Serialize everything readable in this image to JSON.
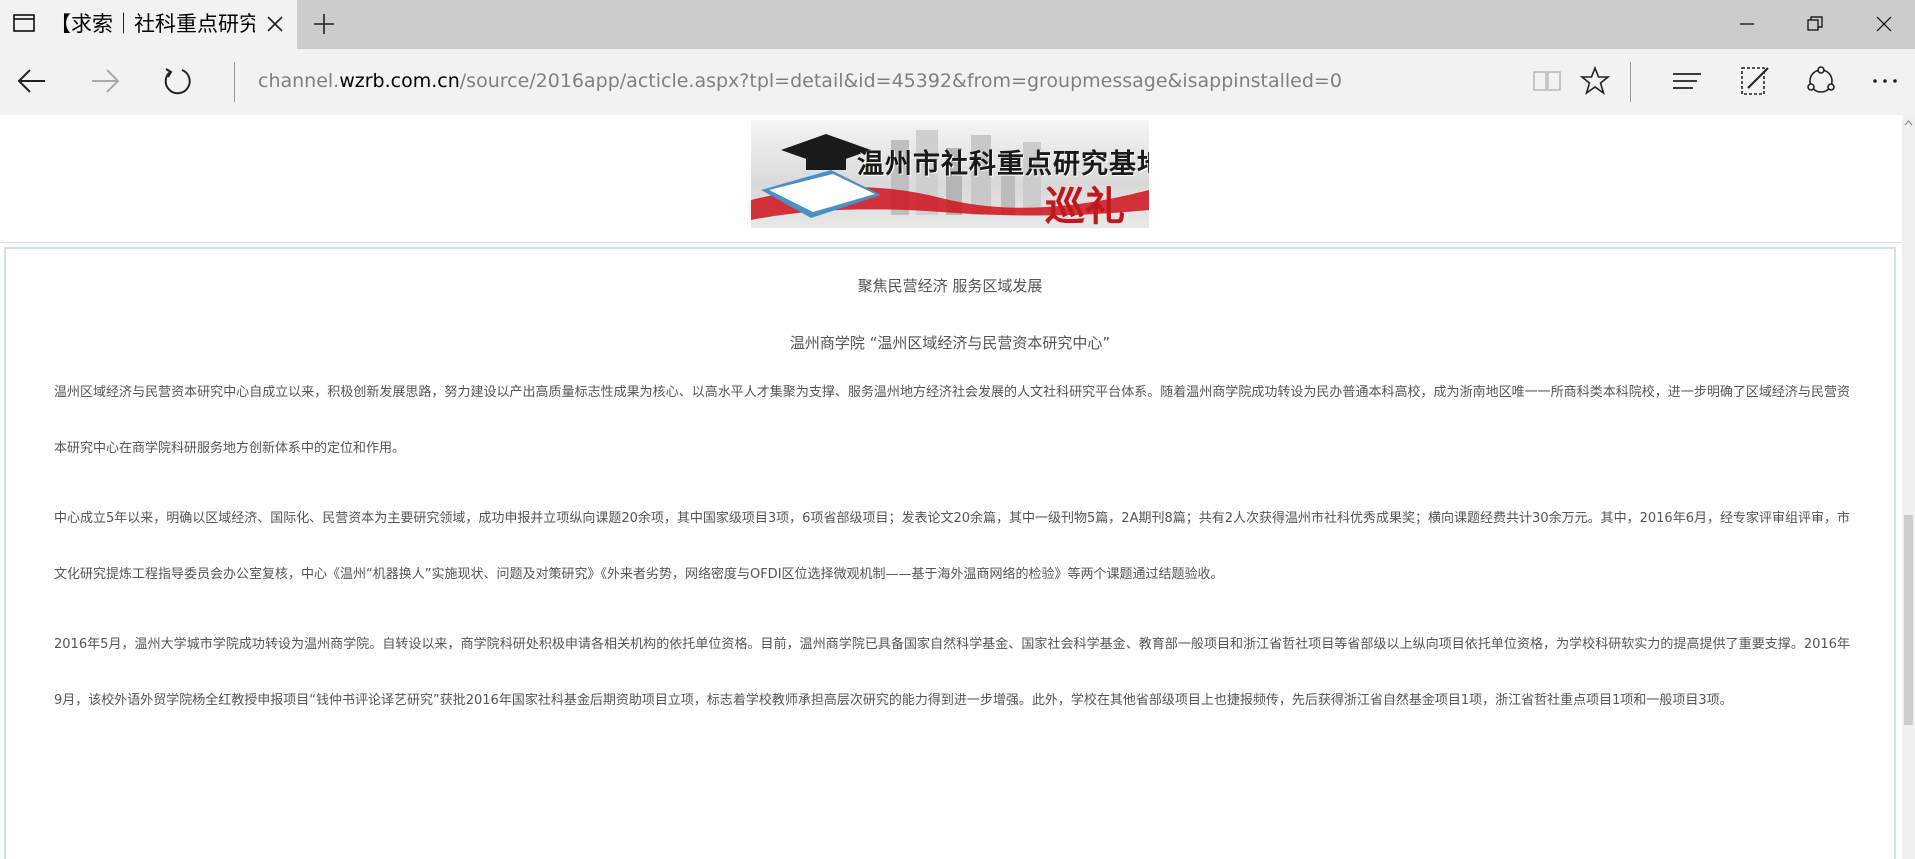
{
  "tab": {
    "title": "【求索｜社科重点研究基地巡礼】"
  },
  "address": {
    "url_prefix": "channel.",
    "url_domain": "wzrb.com.cn",
    "url_path": "/source/2016app/acticle.aspx?tpl=detail&id=45392&from=groupmessage&isappinstalled=0"
  },
  "icons": {
    "tab_page": "page-icon",
    "tab_close": "close-icon",
    "new_tab": "plus-icon",
    "back": "back-arrow-icon",
    "forward": "forward-arrow-icon",
    "refresh": "refresh-icon",
    "reading": "reading-view-icon",
    "favorite": "star-icon",
    "hub": "hub-icon",
    "note": "web-note-icon",
    "share": "share-icon",
    "more": "more-icon"
  },
  "banner": {
    "title": "温州市社科重点研究基地",
    "subtitle": "巡礼"
  },
  "article": {
    "heading1": "聚焦民营经济 服务区域发展",
    "heading2": "温州商学院 “温州区域经济与民营资本研究中心”",
    "paragraphs": [
      "温州区域经济与民营资本研究中心自成立以来，积极创新发展思路，努力建设以产出高质量标志性成果为核心、以高水平人才集聚为支撑、服务温州地方经济社会发展的人文社科研究平台体系。随着温州商学院成功转设为民办普通本科高校，成为浙南地区唯一一所商科类本科院校，进一步明确了区域经济与民营资本研究中心在商学院科研服务地方创新体系中的定位和作用。",
      "中心成立5年以来，明确以区域经济、国际化、民营资本为主要研究领域，成功申报并立项纵向课题20余项，其中国家级项目3项，6项省部级项目；发表论文20余篇，其中一级刊物5篇，2A期刊8篇；共有2人次获得温州市社科优秀成果奖；横向课题经费共计30余万元。其中，2016年6月，经专家评审组评审，市文化研究提炼工程指导委员会办公室复核，中心《温州“机器换人”实施现状、问题及对策研究》《外来者劣势，网络密度与OFDI区位选择微观机制——基于海外温商网络的检验》等两个课题通过结题验收。",
      "2016年5月，温州大学城市学院成功转设为温州商学院。自转设以来，商学院科研处积极申请各相关机构的依托单位资格。目前，温州商学院已具备国家自然科学基金、国家社会科学基金、教育部一般项目和浙江省哲社项目等省部级以上纵向项目依托单位资格，为学校科研软实力的提高提供了重要支撑。2016年9月，该校外语外贸学院杨全红教授申报项目“钱仲书评论译艺研究”获批2016年国家社科基金后期资助项目立项，标志着学校教师承担高层次研究的能力得到进一步增强。此外，学校在其他省部级项目上也捷报频传，先后获得浙江省自然基金项目1项，浙江省哲社重点项目1项和一般项目3项。"
    ]
  }
}
